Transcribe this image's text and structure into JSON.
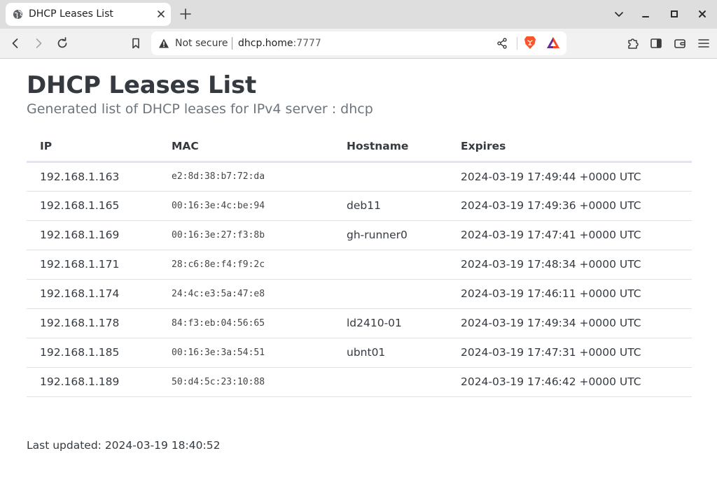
{
  "browser": {
    "tab": {
      "title": "DHCP Leases List",
      "favicon": "globe-icon",
      "close_icon": "close-icon"
    },
    "new_tab_icon": "plus-icon",
    "window_controls": [
      "chevron-down-icon",
      "minimize-icon",
      "maximize-icon",
      "close-icon"
    ],
    "nav": {
      "back_icon": "back-arrow-icon",
      "forward_icon": "forward-arrow-icon",
      "reload_icon": "reload-icon",
      "bookmark_icon": "bookmark-icon"
    },
    "address_bar": {
      "security_label": "Not secure",
      "security_icon": "warning-triangle-icon",
      "url_host": "dhcp.home",
      "url_port": ":7777",
      "share_icon": "share-icon",
      "brave_icon": "brave-lion-icon",
      "rewards_icon": "brave-rewards-icon"
    },
    "toolbar_right_icons": [
      "extensions-puzzle-icon",
      "sidebar-icon",
      "wallet-icon",
      "menu-icon"
    ]
  },
  "page": {
    "title": "DHCP Leases List",
    "subtitle": "Generated list of DHCP leases for IPv4 server : dhcp",
    "table": {
      "headers": {
        "ip": "IP",
        "mac": "MAC",
        "hostname": "Hostname",
        "expires": "Expires"
      },
      "rows": [
        {
          "ip": "192.168.1.163",
          "mac": "e2:8d:38:b7:72:da",
          "hostname": "",
          "expires": "2024-03-19 17:49:44 +0000 UTC"
        },
        {
          "ip": "192.168.1.165",
          "mac": "00:16:3e:4c:be:94",
          "hostname": "deb11",
          "expires": "2024-03-19 17:49:36 +0000 UTC"
        },
        {
          "ip": "192.168.1.169",
          "mac": "00:16:3e:27:f3:8b",
          "hostname": "gh-runner0",
          "expires": "2024-03-19 17:47:41 +0000 UTC"
        },
        {
          "ip": "192.168.1.171",
          "mac": "28:c6:8e:f4:f9:2c",
          "hostname": "",
          "expires": "2024-03-19 17:48:34 +0000 UTC"
        },
        {
          "ip": "192.168.1.174",
          "mac": "24:4c:e3:5a:47:e8",
          "hostname": "",
          "expires": "2024-03-19 17:46:11 +0000 UTC"
        },
        {
          "ip": "192.168.1.178",
          "mac": "84:f3:eb:04:56:65",
          "hostname": "ld2410-01",
          "expires": "2024-03-19 17:49:34 +0000 UTC"
        },
        {
          "ip": "192.168.1.185",
          "mac": "00:16:3e:3a:54:51",
          "hostname": "ubnt01",
          "expires": "2024-03-19 17:47:31 +0000 UTC"
        },
        {
          "ip": "192.168.1.189",
          "mac": "50:d4:5c:23:10:88",
          "hostname": "",
          "expires": "2024-03-19 17:46:42 +0000 UTC"
        }
      ]
    },
    "last_updated": "Last updated: 2024-03-19 18:40:52"
  }
}
